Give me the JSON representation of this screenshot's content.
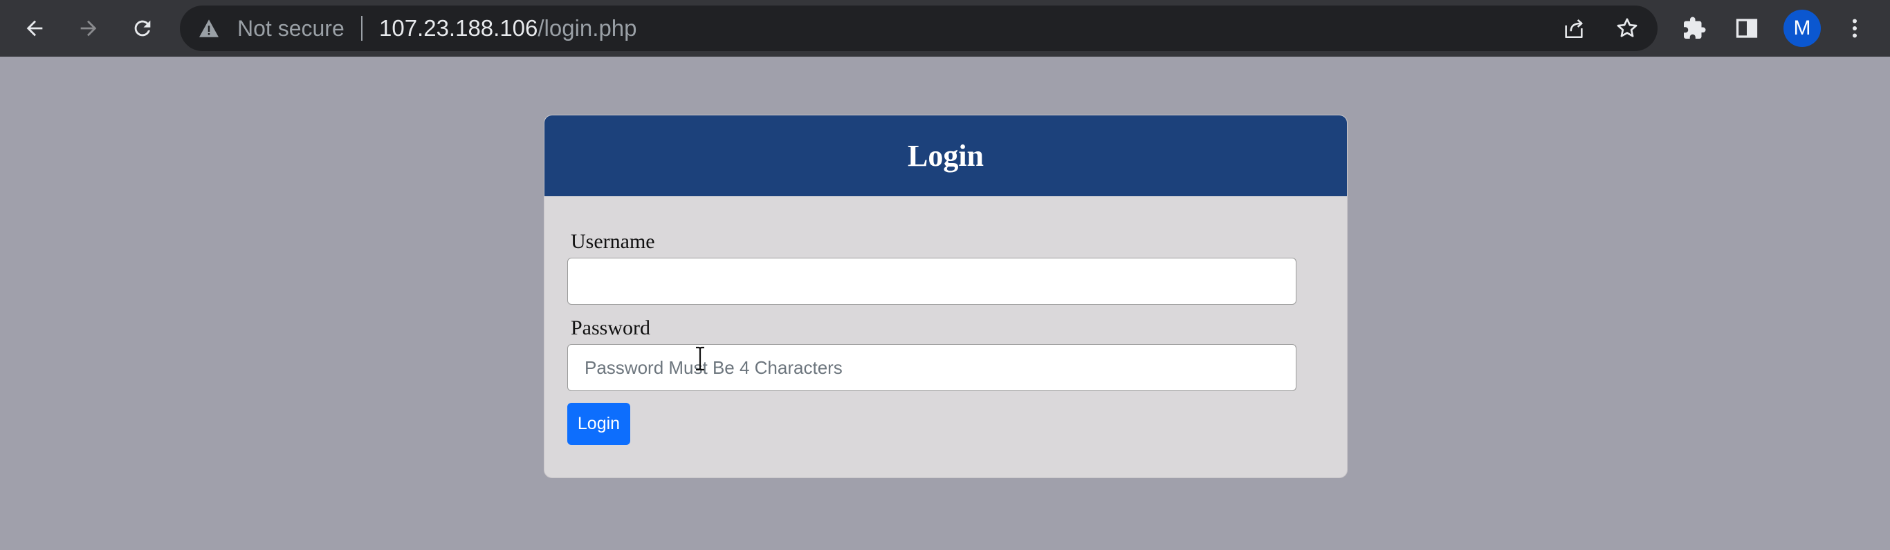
{
  "browser": {
    "security_status": "Not secure",
    "url_host": "107.23.188.106",
    "url_path": "/login.php",
    "profile_initial": "M",
    "profile_color": "#0b57d0",
    "icons": {
      "back": "arrow-left-icon",
      "forward": "arrow-right-icon",
      "reload": "reload-icon",
      "warning": "warning-triangle-icon",
      "share": "share-icon",
      "bookmark": "star-icon",
      "extensions": "puzzle-icon",
      "side_panel": "side-panel-icon",
      "menu": "kebab-menu-icon"
    }
  },
  "login": {
    "title": "Login",
    "header_color": "#1c417b",
    "username": {
      "label": "Username",
      "value": "",
      "placeholder": ""
    },
    "password": {
      "label": "Password",
      "value": "",
      "placeholder": "Password Must Be 4 Characters"
    },
    "submit_label": "Login",
    "submit_color": "#0d6efd"
  }
}
